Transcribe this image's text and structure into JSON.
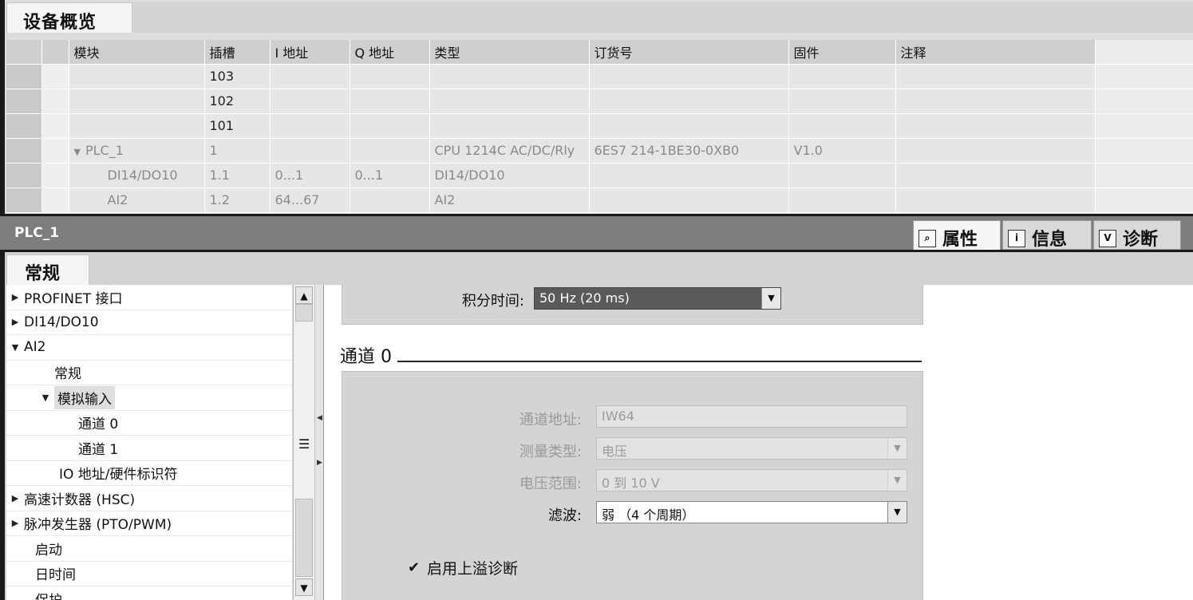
{
  "device_overview": {
    "tab_label": "设备概览",
    "columns": [
      "模块",
      "插槽",
      "I 地址",
      "Q 地址",
      "类型",
      "订货号",
      "固件",
      "注释"
    ],
    "rows": [
      {
        "module": "",
        "slot": "103",
        "i_addr": "",
        "q_addr": "",
        "type": "",
        "order_no": "",
        "firmware": "",
        "comment": ""
      },
      {
        "module": "",
        "slot": "102",
        "i_addr": "",
        "q_addr": "",
        "type": "",
        "order_no": "",
        "firmware": "",
        "comment": ""
      },
      {
        "module": "",
        "slot": "101",
        "i_addr": "",
        "q_addr": "",
        "type": "",
        "order_no": "",
        "firmware": "",
        "comment": ""
      },
      {
        "module": "PLC_1",
        "slot": "1",
        "i_addr": "",
        "q_addr": "",
        "type": "CPU 1214C AC/DC/Rly",
        "order_no": "6ES7 214-1BE30-0XB0",
        "firmware": "V1.0",
        "comment": ""
      },
      {
        "module": "DI14/DO10",
        "slot": "1.1",
        "i_addr": "0...1",
        "q_addr": "0...1",
        "type": "DI14/DO10",
        "order_no": "",
        "firmware": "",
        "comment": ""
      },
      {
        "module": "AI2",
        "slot": "1.2",
        "i_addr": "64...67",
        "q_addr": "",
        "type": "AI2",
        "order_no": "",
        "firmware": "",
        "comment": ""
      }
    ]
  },
  "inspector": {
    "title": "PLC_1",
    "tabs": [
      {
        "label": "属性",
        "icon": "properties-icon"
      },
      {
        "label": "信息",
        "icon": "info-icon"
      },
      {
        "label": "诊断",
        "icon": "diagnostics-icon"
      }
    ]
  },
  "properties": {
    "tab_label": "常规",
    "nav": [
      {
        "label": "PROFINET 接口",
        "arrow": "right"
      },
      {
        "label": "DI14/DO10",
        "arrow": "right"
      },
      {
        "label": "AI2",
        "arrow": "down"
      },
      {
        "label": "常规",
        "arrow": ""
      },
      {
        "label": "模拟输入",
        "arrow": "down"
      },
      {
        "label": "通道 0",
        "arrow": ""
      },
      {
        "label": "通道 1",
        "arrow": ""
      },
      {
        "label": "IO 地址/硬件标识符",
        "arrow": ""
      },
      {
        "label": "高速计数器 (HSC)",
        "arrow": "right"
      },
      {
        "label": "脉冲发生器 (PTO/PWM)",
        "arrow": "right"
      },
      {
        "label": "启动",
        "arrow": ""
      },
      {
        "label": "日时间",
        "arrow": ""
      },
      {
        "label": "保护",
        "arrow": ""
      }
    ],
    "integration_label": "积分时间:",
    "integration_value": "50 Hz (20 ms)",
    "channel_title": "通道 0",
    "channel_address_label": "通道地址:",
    "channel_address_value": "IW64",
    "measure_type_label": "测量类型:",
    "measure_type_value": "电压",
    "voltage_range_label": "电压范围:",
    "voltage_range_value": "0 到 10 V",
    "filter_label": "滤波:",
    "filter_value": "弱 （4 个周期）",
    "overflow_label": "启用上溢诊断",
    "overflow_checked": true
  }
}
